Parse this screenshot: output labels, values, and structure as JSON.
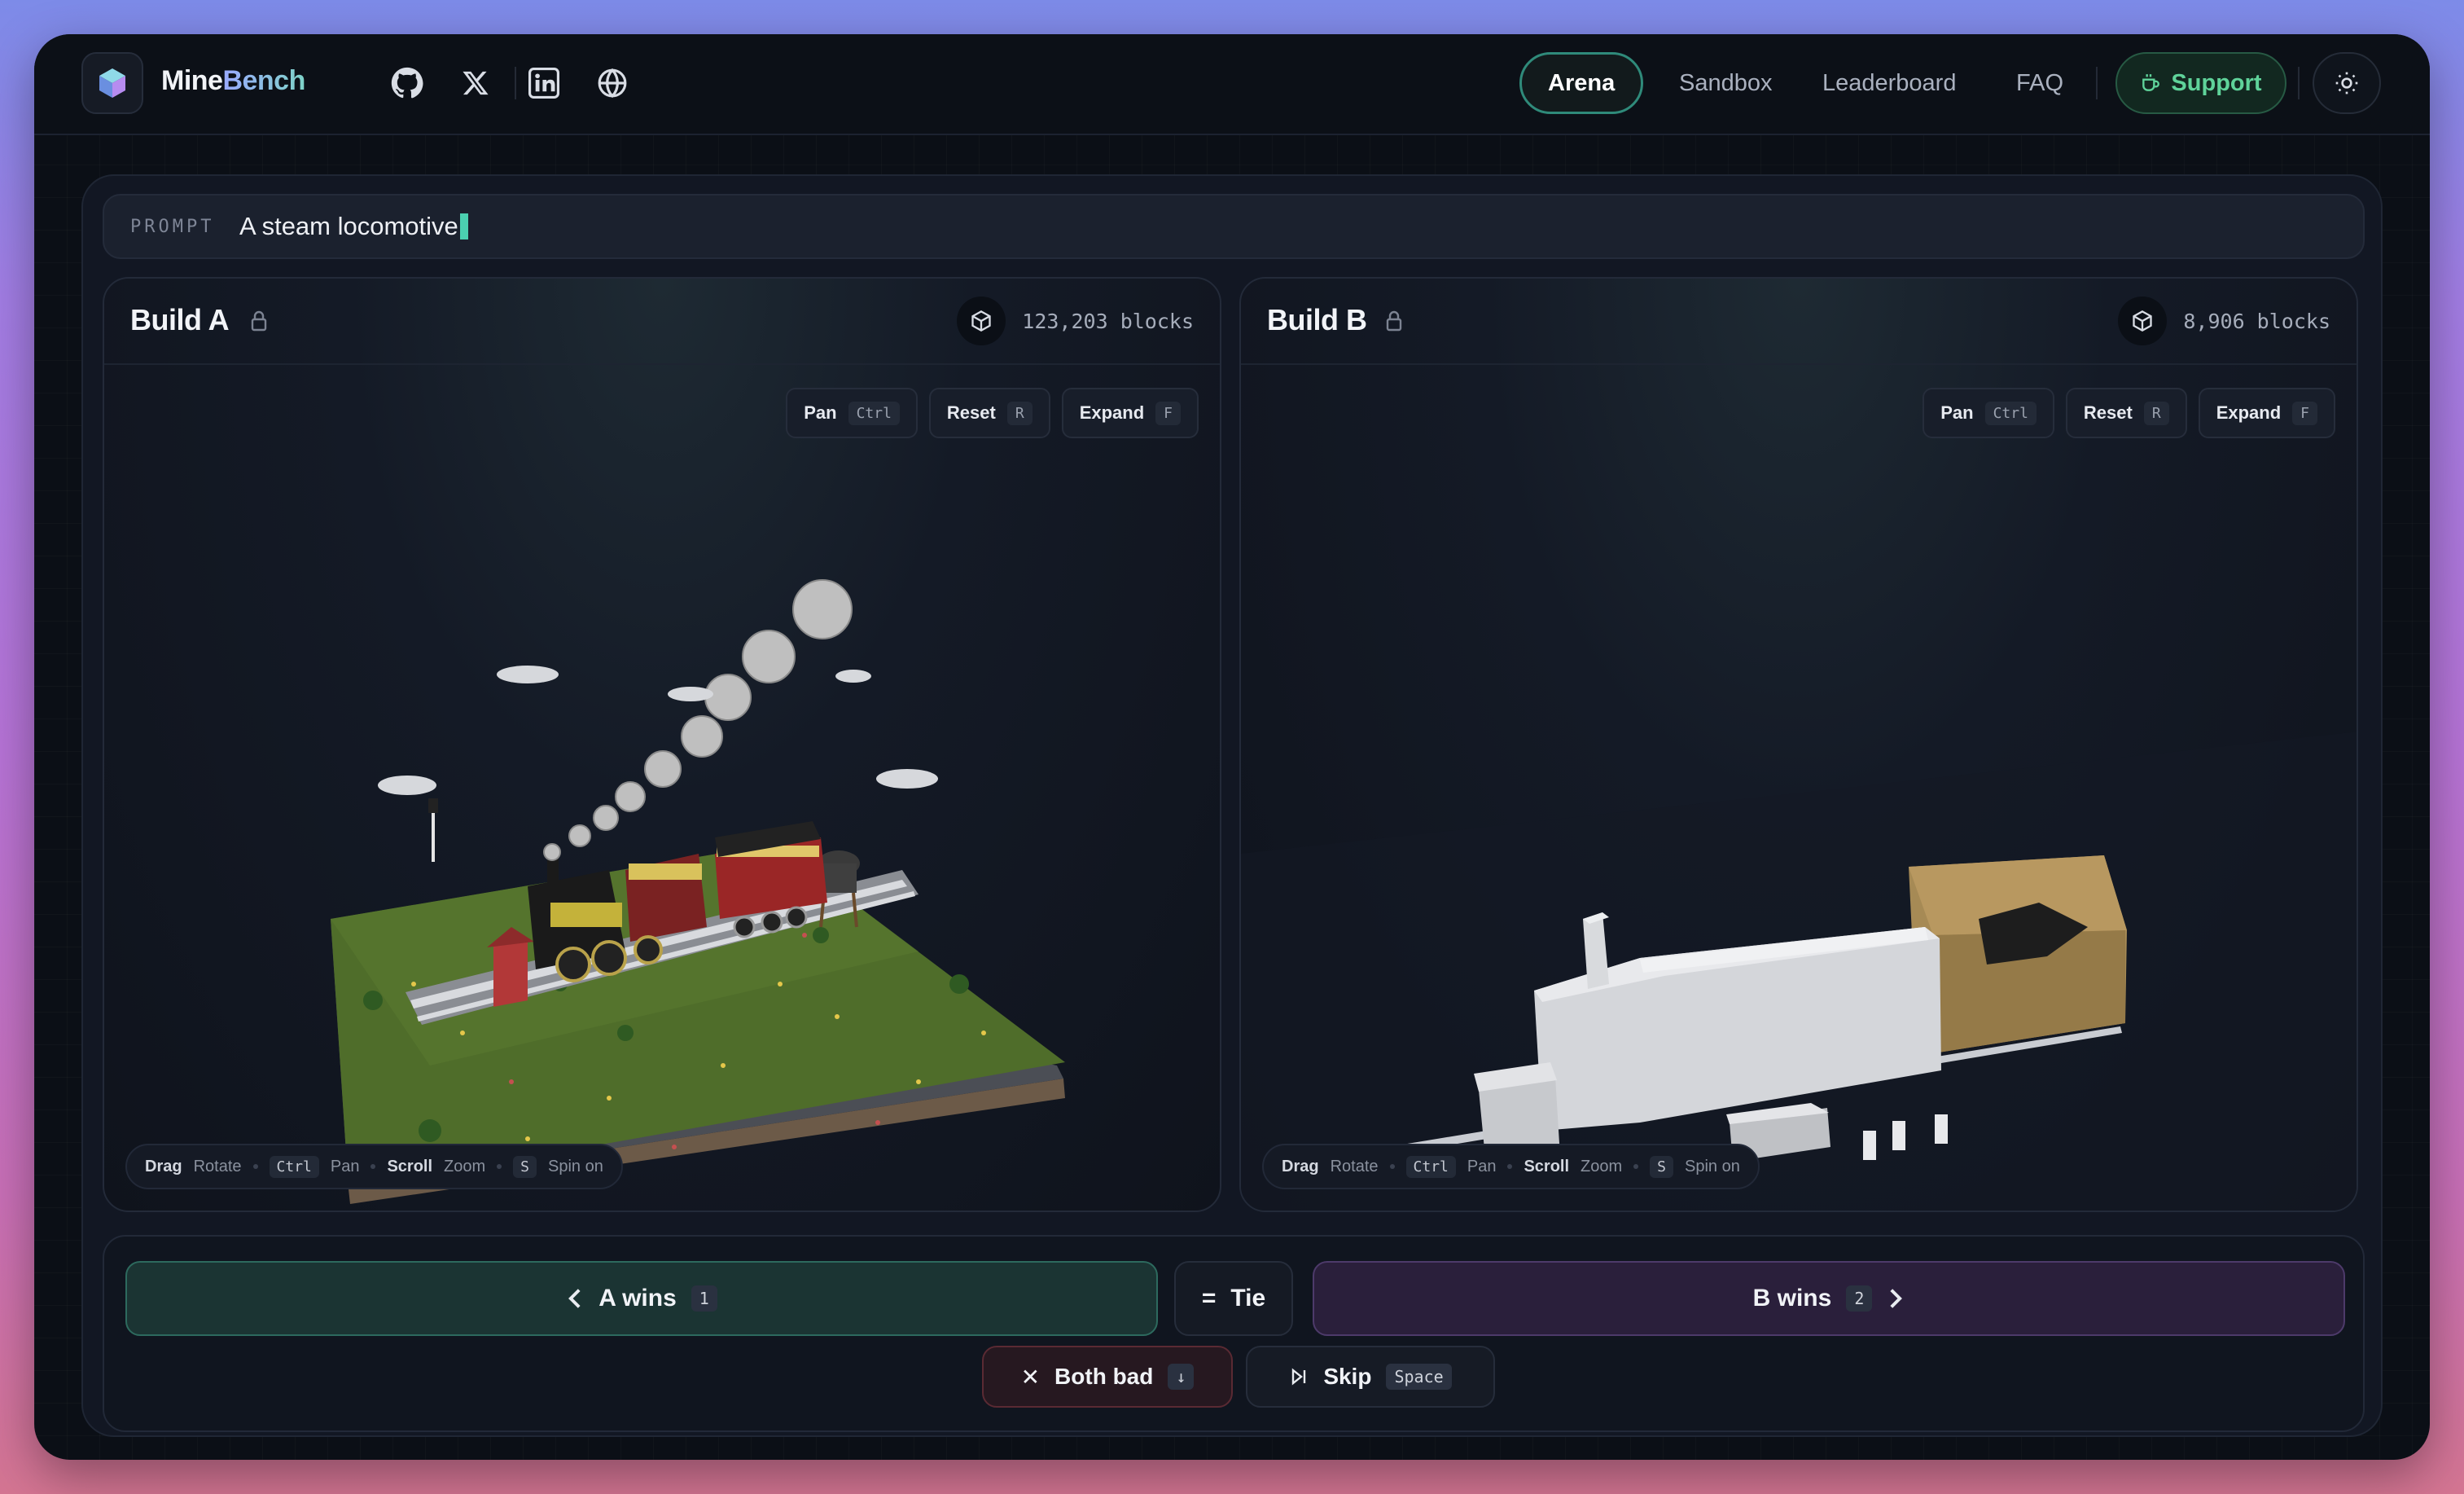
{
  "brand": {
    "name_part1": "Mine",
    "name_part2": "Bench"
  },
  "header_icons": [
    "github-icon",
    "x-icon",
    "linkedin-icon",
    "globe-icon"
  ],
  "nav": {
    "arena": "Arena",
    "sandbox": "Sandbox",
    "leaderboard": "Leaderboard",
    "faq": "FAQ",
    "support": "Support"
  },
  "prompt": {
    "label": "PROMPT",
    "text": "A steam locomotive"
  },
  "build_a": {
    "title": "Build A",
    "blocks": "123,203 blocks"
  },
  "build_b": {
    "title": "Build B",
    "blocks": "8,906 blocks"
  },
  "controls": {
    "pan": "Pan",
    "pan_key": "Ctrl",
    "reset": "Reset",
    "reset_key": "R",
    "expand": "Expand",
    "expand_key": "F"
  },
  "hints": {
    "drag": "Drag",
    "rotate": "Rotate",
    "ctrl": "Ctrl",
    "pan": "Pan",
    "scroll": "Scroll",
    "zoom": "Zoom",
    "s": "S",
    "spin": "Spin on"
  },
  "vote": {
    "a_wins": "A wins",
    "a_key": "1",
    "tie": "Tie",
    "b_wins": "B wins",
    "b_key": "2",
    "both_bad": "Both bad",
    "both_bad_key": "↓",
    "skip": "Skip",
    "skip_key": "Space"
  },
  "colors": {
    "accent_teal": "#2f8a7a",
    "support_green": "#5fd39a",
    "b_purple": "#5a3f7a",
    "bad_red": "#6a2a33"
  }
}
